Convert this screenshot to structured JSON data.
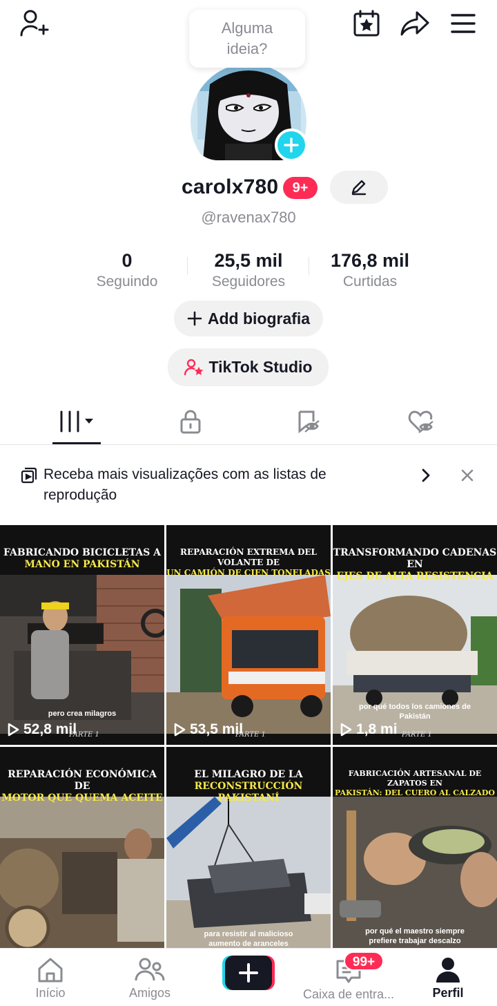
{
  "topbar": {
    "add_friend_icon": "person-plus-icon",
    "calendar_icon": "calendar-star-icon",
    "share_icon": "share-arrow-icon",
    "menu_icon": "hamburger-menu-icon"
  },
  "bubble": {
    "line1": "Alguma",
    "line2": "ideia?"
  },
  "profile": {
    "username": "carolx780",
    "notif_badge": "9+",
    "handle": "@ravenax780"
  },
  "stats": [
    {
      "value": "0",
      "label": "Seguindo"
    },
    {
      "value": "25,5 mil",
      "label": "Seguidores"
    },
    {
      "value": "176,8 mil",
      "label": "Curtidas"
    }
  ],
  "buttons": {
    "add_bio": "Add biografia",
    "studio": "TikTok Studio"
  },
  "tabs": [
    "videos-grid",
    "private",
    "reposts",
    "liked"
  ],
  "banner": {
    "text": "Receba mais visualizações com as listas de reprodução"
  },
  "videos": [
    {
      "title_line1": "FABRICANDO BICICLETAS A",
      "title_line2": "MANO EN PAKISTÁN",
      "caption": "pero crea milagros",
      "views": "52,8 mil",
      "parte": "PARTE 1"
    },
    {
      "title_line1": "REPARACIÓN EXTREMA DEL VOLANTE DE",
      "title_line2": "UN CAMIÓN DE CIEN TONELADAS",
      "caption": "",
      "views": "53,5 mil",
      "parte": "PARTE 1"
    },
    {
      "title_line1": "TRANSFORMANDO CADENAS EN",
      "title_line2": "EJES DE ALTA RESISTENCIA",
      "caption": "por qué todos los camiones de Pakistán",
      "views": "1,8 mi",
      "parte": "PARTE 1"
    },
    {
      "title_line1": "REPARACIÓN ECONÓMICA DE",
      "title_line2": "MOTOR QUE QUEMA ACEITE",
      "caption": "",
      "views": "",
      "parte": ""
    },
    {
      "title_line1": "EL MILAGRO DE LA",
      "title_line2": "RECONSTRUCCIÓN PAKISTANÍ",
      "caption": "para resistir al malicioso aumento de aranceles",
      "views": "",
      "parte": ""
    },
    {
      "title_line1": "FABRICACIÓN ARTESANAL DE ZAPATOS EN",
      "title_line2": "PAKISTÁN: DEL CUERO AL CALZADO",
      "caption": "por qué el maestro siempre prefiere trabajar descalzo",
      "views": "",
      "parte": ""
    }
  ],
  "nav": {
    "home": "Início",
    "friends": "Amigos",
    "inbox": "Caixa de entra...",
    "inbox_badge": "99+",
    "profile": "Perfil"
  },
  "colors": {
    "accent": "#fe2c55",
    "cyan": "#20d5ec",
    "highlight": "#f6e94a"
  }
}
